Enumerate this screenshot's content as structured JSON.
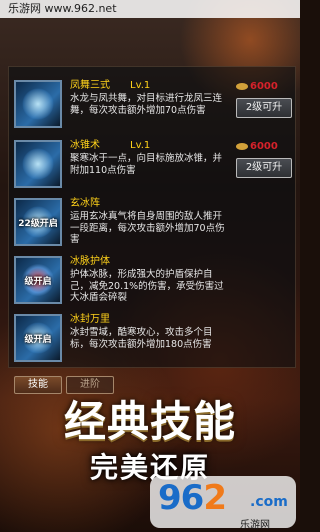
{
  "site_header": {
    "text": "乐游网 www.962.net"
  },
  "skills": [
    {
      "name": "凤舞三式",
      "level": "Lv.1",
      "description": "水龙与凤共舞，对目标进行龙凤三连舞，每次攻击额外增加70点伤害",
      "cost": "6000",
      "upgrade_label": "2级可升",
      "icon": "water-dragon-icon",
      "icon_label": ""
    },
    {
      "name": "冰锥术",
      "level": "Lv.1",
      "description": "聚寒冰于一点，向目标施放冰锥，并附加110点伤害",
      "cost": "6000",
      "upgrade_label": "2级可升",
      "icon": "ice-spike-icon",
      "icon_label": ""
    },
    {
      "name": "玄冰阵",
      "level": "",
      "description": "运用玄冰真气将自身周围的敌人推开一段距离，每次攻击额外增加70点伤害",
      "cost": "",
      "upgrade_label": "",
      "icon": "ice-array-icon",
      "icon_label": "22级开启"
    },
    {
      "name": "冰脉护体",
      "level": "",
      "description": "护体冰脉，形成强大的护盾保护自己，减免20.1%的伤害，承受伤害过大冰盾会碎裂",
      "cost": "",
      "upgrade_label": "",
      "icon": "ice-shield-icon",
      "icon_label": "级开启"
    },
    {
      "name": "冰封万里",
      "level": "",
      "description": "冰封雪域，酷寒攻心，攻击多个目标，每次攻击额外增加180点伤害",
      "cost": "",
      "upgrade_label": "",
      "icon": "ice-seal-icon",
      "icon_label": "级开启"
    }
  ],
  "tabs": [
    {
      "label": "技能"
    },
    {
      "label": "进阶"
    }
  ],
  "promo": {
    "title": "经典技能",
    "subtitle": "完美还原"
  },
  "watermark": {
    "num_main": "96",
    "num_accent": "2",
    "com": ".com",
    "site": "乐游网"
  },
  "colors": {
    "skill_name": "#ffd21a",
    "cost": "#d6212a",
    "watermark_blue": "#1a6cc8",
    "watermark_orange": "#f07a1a"
  }
}
